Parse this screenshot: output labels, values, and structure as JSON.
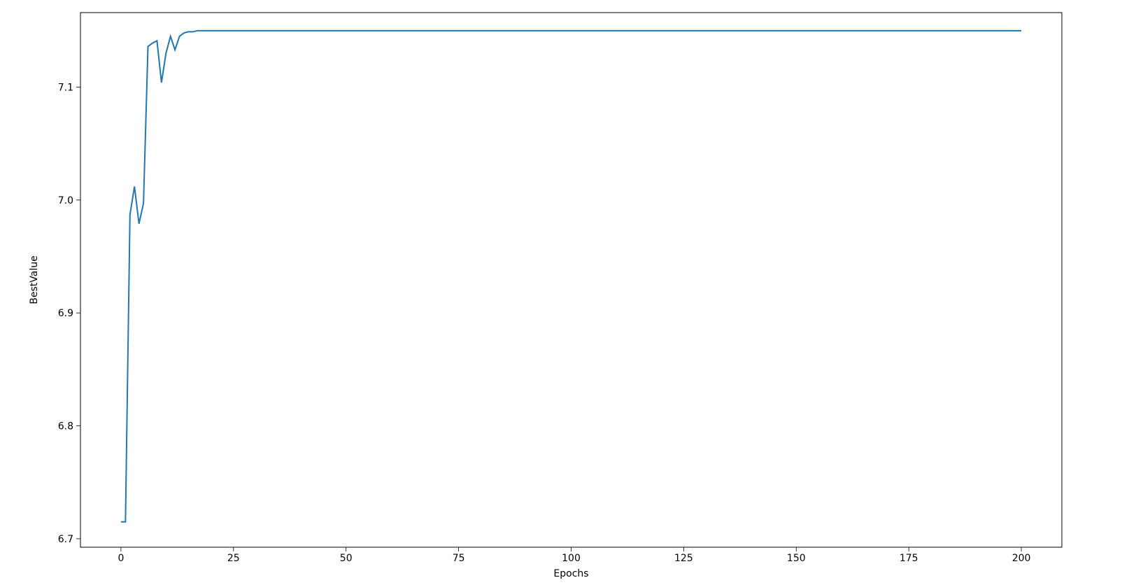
{
  "chart_data": {
    "type": "line",
    "xlabel": "Epochs",
    "ylabel": "BestValue",
    "title": "",
    "xlim": [
      -9,
      209
    ],
    "ylim": [
      6.6925,
      7.166
    ],
    "xticks": [
      0,
      25,
      50,
      75,
      100,
      125,
      150,
      175,
      200
    ],
    "yticks": [
      6.7,
      6.8,
      6.9,
      7.0,
      7.1
    ],
    "series": [
      {
        "name": "BestValue",
        "x": [
          0,
          1,
          2,
          3,
          4,
          5,
          6,
          7,
          8,
          9,
          10,
          11,
          12,
          13,
          14,
          15,
          16,
          17,
          18,
          19,
          20,
          25,
          30,
          35,
          40,
          45,
          50,
          60,
          70,
          80,
          90,
          100,
          110,
          120,
          130,
          140,
          150,
          160,
          170,
          180,
          190,
          200
        ],
        "y": [
          6.715,
          6.715,
          6.987,
          7.012,
          6.979,
          6.997,
          7.136,
          7.139,
          7.141,
          7.104,
          7.13,
          7.145,
          7.133,
          7.145,
          7.148,
          7.149,
          7.149,
          7.15,
          7.15,
          7.15,
          7.15,
          7.15,
          7.15,
          7.15,
          7.15,
          7.15,
          7.15,
          7.15,
          7.15,
          7.15,
          7.15,
          7.15,
          7.15,
          7.15,
          7.15,
          7.15,
          7.15,
          7.15,
          7.15,
          7.15,
          7.15,
          7.15
        ]
      }
    ]
  },
  "axes": {
    "xlabel": "Epochs",
    "ylabel": "BestValue",
    "xticks": [
      "0",
      "25",
      "50",
      "75",
      "100",
      "125",
      "150",
      "175",
      "200"
    ],
    "yticks": [
      "6.7",
      "6.8",
      "6.9",
      "7.0",
      "7.1"
    ]
  },
  "colors": {
    "line": "#1f77b4",
    "axis": "#000000",
    "background": "#ffffff"
  }
}
